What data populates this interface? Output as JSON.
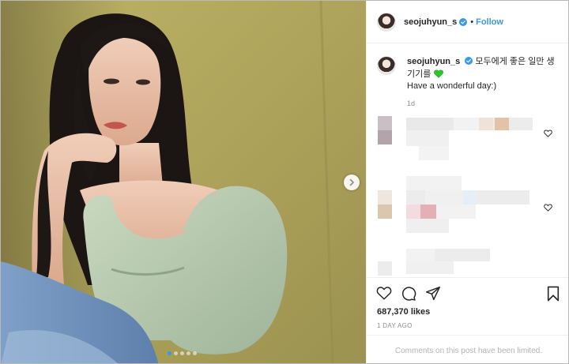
{
  "post": {
    "username": "seojuhyun_s",
    "separator": "•",
    "follow_label": "Follow",
    "caption_line1": "모두에게 좋은 일만 생",
    "caption_line2": "기기를",
    "caption_emoji": "green-heart-icon",
    "caption_line3": "Have a wonderful day:)",
    "caption_time": "1d",
    "likes": "687,370 likes",
    "date": "1 DAY AGO",
    "comments_limited": "Comments on this post have been limited.",
    "carousel": {
      "total": 5,
      "active": 1
    }
  },
  "colors": {
    "link_blue": "#3897f0",
    "verified_blue": "#3897f0",
    "heart_green": "#2ec52e",
    "muted": "#8e8e8e"
  },
  "icons": [
    "verified-icon",
    "next-arrow-icon",
    "heart-outline-icon",
    "comment-icon",
    "share-icon",
    "bookmark-icon"
  ]
}
